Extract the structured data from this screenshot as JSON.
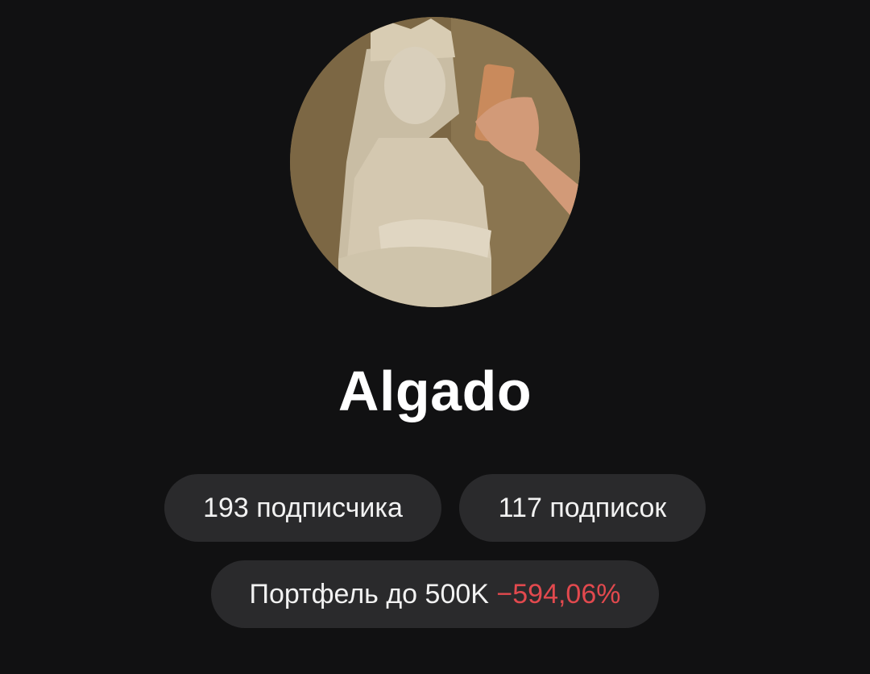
{
  "profile": {
    "username": "Algado",
    "avatar_icon": "statue-photo-avatar"
  },
  "stats": {
    "followers_label": "193 подписчика",
    "following_label": "117 подписок"
  },
  "portfolio": {
    "label": "Портфель до 500K",
    "change": "−594,06%",
    "change_color": "#e2494e"
  }
}
